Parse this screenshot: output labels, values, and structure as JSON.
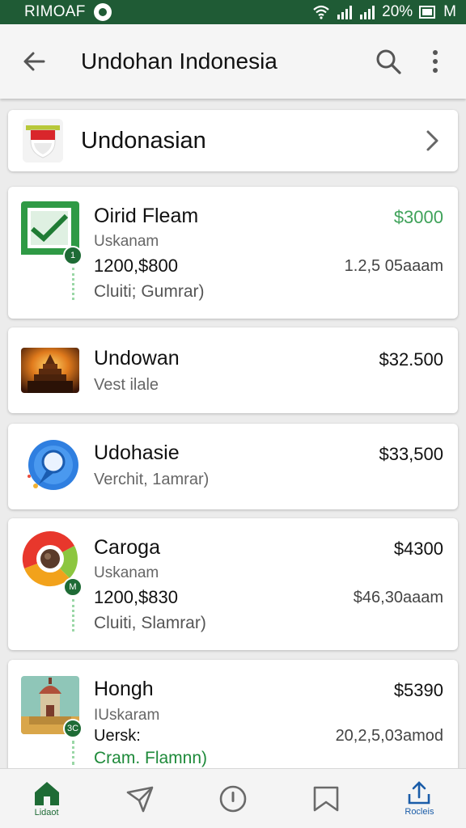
{
  "status_bar": {
    "carrier": "RIMOAF",
    "battery": "20%",
    "network": "M"
  },
  "app_bar": {
    "title": "Undohan Indonesia",
    "icons": [
      "back-arrow-icon",
      "search-icon",
      "more-vert-icon"
    ]
  },
  "selector": {
    "label": "Undonasian",
    "icon": "indonesia-flag-icon"
  },
  "items": [
    {
      "name": "Oirid Fleam",
      "sub": "Uskanam",
      "line3": "1200,$800",
      "line4": "Cluiti; Gumrar)",
      "price": "$3000",
      "price_color": "#3fa25a",
      "sub_right": "1.2,5 05aaam",
      "badge": "1",
      "icon": "green-check-app-icon"
    },
    {
      "name": "Undowan",
      "sub": "Vest ilale",
      "price": "$32.500",
      "icon": "temple-photo-icon"
    },
    {
      "name": "Udohasie",
      "sub": "Verchit, 1amrar)",
      "price": "$33,500",
      "icon": "blue-pin-icon"
    },
    {
      "name": "Caroga",
      "sub": "Uskanam",
      "line3": "1200,$830",
      "line4": "Cluiti, Slamrar)",
      "price": "$4300",
      "sub_right": "$46,30aaam",
      "badge": "M",
      "icon": "chrome-ring-icon"
    },
    {
      "name": "Hongh",
      "sub": "IUskaram",
      "line3": "Uersk:",
      "line4": "Cram. Flamnn)",
      "line4_color": "#1e8a3a",
      "price": "$5390",
      "sub_right": "20,2,5,03amod",
      "badge": "3C",
      "icon": "tower-building-icon"
    }
  ],
  "bottom_nav": [
    {
      "label": "Lidaot",
      "icon": "home-icon",
      "active": true,
      "color": "#1e6b35"
    },
    {
      "label": "",
      "icon": "send-icon"
    },
    {
      "label": "",
      "icon": "info-circle-icon"
    },
    {
      "label": "",
      "icon": "bookmark-icon"
    },
    {
      "label": "Rocleis",
      "icon": "upload-icon",
      "color": "#1a5ca8"
    }
  ]
}
